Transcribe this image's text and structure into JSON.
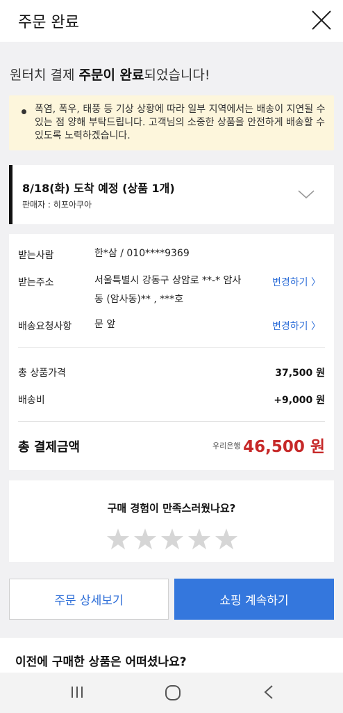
{
  "header": {
    "title": "주문 완료"
  },
  "complete": {
    "prefix": "원터치 결제 ",
    "bold": "주문이 완료",
    "suffix": "되었습니다!"
  },
  "notice": {
    "text": "폭염, 폭우, 태풍 등 기상 상황에 따라 일부 지역에서는 배송이 지연될 수 있는 점 양해 부탁드립니다. 고객님의 소중한 상품을 안전하게 배송할 수 있도록 노력하겠습니다."
  },
  "delivery": {
    "eta": "8/18(화) 도착 예정 (상품 1개)",
    "seller": "판매자 : 히포아쿠아"
  },
  "shipping": {
    "recipient_label": "받는사람",
    "recipient_value": "한*삼 / 010****9369",
    "address_label": "받는주소",
    "address_line1": "서울특별시 강동구 상암로 **-* 암사",
    "address_line2": "동 (암사동)** , ***호",
    "address_change": "변경하기 〉",
    "request_label": "배송요청사항",
    "request_value": "문 앞",
    "request_change": "변경하기 〉"
  },
  "payment": {
    "product_price_label": "총 상품가격",
    "product_price": "37,500 원",
    "shipping_fee_label": "배송비",
    "shipping_fee": "+9,000 원",
    "total_label": "총 결제금액",
    "bank": "우리은행",
    "total": "46,500 원"
  },
  "review": {
    "question": "구매 경험이 만족스러웠나요?",
    "rating": 0,
    "max_rating": 5
  },
  "buttons": {
    "detail": "주문 상세보기",
    "shop": "쇼핑 계속하기"
  },
  "previous": {
    "title": "이전에 구매한 상품은 어떠셨나요?"
  },
  "colors": {
    "accent": "#3477dd",
    "link": "#2f6fd8",
    "total": "#c62828",
    "notice_bg": "#fdf6dc"
  }
}
